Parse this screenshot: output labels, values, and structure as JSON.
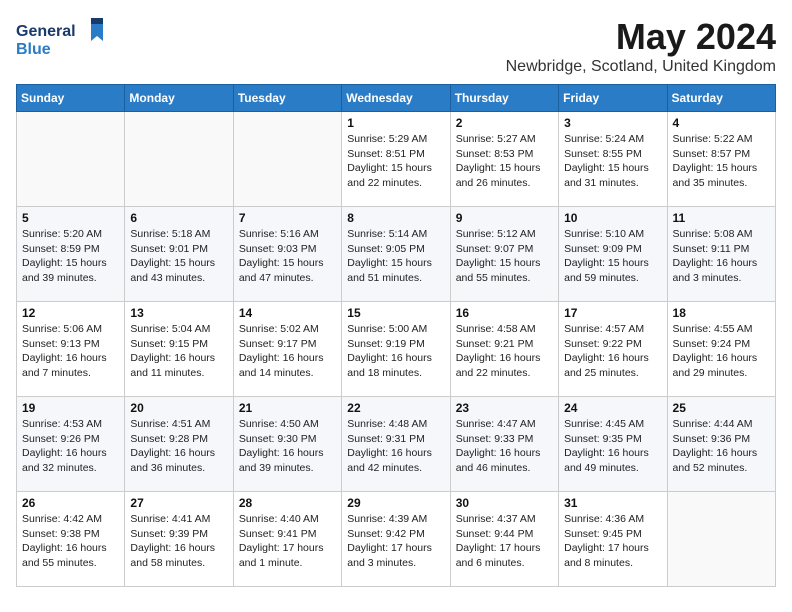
{
  "header": {
    "logo_general": "General",
    "logo_blue": "Blue",
    "month_title": "May 2024",
    "location": "Newbridge, Scotland, United Kingdom"
  },
  "days_of_week": [
    "Sunday",
    "Monday",
    "Tuesday",
    "Wednesday",
    "Thursday",
    "Friday",
    "Saturday"
  ],
  "weeks": [
    [
      {
        "day": "",
        "sunrise": "",
        "sunset": "",
        "daylight": ""
      },
      {
        "day": "",
        "sunrise": "",
        "sunset": "",
        "daylight": ""
      },
      {
        "day": "",
        "sunrise": "",
        "sunset": "",
        "daylight": ""
      },
      {
        "day": "1",
        "sunrise": "Sunrise: 5:29 AM",
        "sunset": "Sunset: 8:51 PM",
        "daylight": "Daylight: 15 hours and 22 minutes."
      },
      {
        "day": "2",
        "sunrise": "Sunrise: 5:27 AM",
        "sunset": "Sunset: 8:53 PM",
        "daylight": "Daylight: 15 hours and 26 minutes."
      },
      {
        "day": "3",
        "sunrise": "Sunrise: 5:24 AM",
        "sunset": "Sunset: 8:55 PM",
        "daylight": "Daylight: 15 hours and 31 minutes."
      },
      {
        "day": "4",
        "sunrise": "Sunrise: 5:22 AM",
        "sunset": "Sunset: 8:57 PM",
        "daylight": "Daylight: 15 hours and 35 minutes."
      }
    ],
    [
      {
        "day": "5",
        "sunrise": "Sunrise: 5:20 AM",
        "sunset": "Sunset: 8:59 PM",
        "daylight": "Daylight: 15 hours and 39 minutes."
      },
      {
        "day": "6",
        "sunrise": "Sunrise: 5:18 AM",
        "sunset": "Sunset: 9:01 PM",
        "daylight": "Daylight: 15 hours and 43 minutes."
      },
      {
        "day": "7",
        "sunrise": "Sunrise: 5:16 AM",
        "sunset": "Sunset: 9:03 PM",
        "daylight": "Daylight: 15 hours and 47 minutes."
      },
      {
        "day": "8",
        "sunrise": "Sunrise: 5:14 AM",
        "sunset": "Sunset: 9:05 PM",
        "daylight": "Daylight: 15 hours and 51 minutes."
      },
      {
        "day": "9",
        "sunrise": "Sunrise: 5:12 AM",
        "sunset": "Sunset: 9:07 PM",
        "daylight": "Daylight: 15 hours and 55 minutes."
      },
      {
        "day": "10",
        "sunrise": "Sunrise: 5:10 AM",
        "sunset": "Sunset: 9:09 PM",
        "daylight": "Daylight: 15 hours and 59 minutes."
      },
      {
        "day": "11",
        "sunrise": "Sunrise: 5:08 AM",
        "sunset": "Sunset: 9:11 PM",
        "daylight": "Daylight: 16 hours and 3 minutes."
      }
    ],
    [
      {
        "day": "12",
        "sunrise": "Sunrise: 5:06 AM",
        "sunset": "Sunset: 9:13 PM",
        "daylight": "Daylight: 16 hours and 7 minutes."
      },
      {
        "day": "13",
        "sunrise": "Sunrise: 5:04 AM",
        "sunset": "Sunset: 9:15 PM",
        "daylight": "Daylight: 16 hours and 11 minutes."
      },
      {
        "day": "14",
        "sunrise": "Sunrise: 5:02 AM",
        "sunset": "Sunset: 9:17 PM",
        "daylight": "Daylight: 16 hours and 14 minutes."
      },
      {
        "day": "15",
        "sunrise": "Sunrise: 5:00 AM",
        "sunset": "Sunset: 9:19 PM",
        "daylight": "Daylight: 16 hours and 18 minutes."
      },
      {
        "day": "16",
        "sunrise": "Sunrise: 4:58 AM",
        "sunset": "Sunset: 9:21 PM",
        "daylight": "Daylight: 16 hours and 22 minutes."
      },
      {
        "day": "17",
        "sunrise": "Sunrise: 4:57 AM",
        "sunset": "Sunset: 9:22 PM",
        "daylight": "Daylight: 16 hours and 25 minutes."
      },
      {
        "day": "18",
        "sunrise": "Sunrise: 4:55 AM",
        "sunset": "Sunset: 9:24 PM",
        "daylight": "Daylight: 16 hours and 29 minutes."
      }
    ],
    [
      {
        "day": "19",
        "sunrise": "Sunrise: 4:53 AM",
        "sunset": "Sunset: 9:26 PM",
        "daylight": "Daylight: 16 hours and 32 minutes."
      },
      {
        "day": "20",
        "sunrise": "Sunrise: 4:51 AM",
        "sunset": "Sunset: 9:28 PM",
        "daylight": "Daylight: 16 hours and 36 minutes."
      },
      {
        "day": "21",
        "sunrise": "Sunrise: 4:50 AM",
        "sunset": "Sunset: 9:30 PM",
        "daylight": "Daylight: 16 hours and 39 minutes."
      },
      {
        "day": "22",
        "sunrise": "Sunrise: 4:48 AM",
        "sunset": "Sunset: 9:31 PM",
        "daylight": "Daylight: 16 hours and 42 minutes."
      },
      {
        "day": "23",
        "sunrise": "Sunrise: 4:47 AM",
        "sunset": "Sunset: 9:33 PM",
        "daylight": "Daylight: 16 hours and 46 minutes."
      },
      {
        "day": "24",
        "sunrise": "Sunrise: 4:45 AM",
        "sunset": "Sunset: 9:35 PM",
        "daylight": "Daylight: 16 hours and 49 minutes."
      },
      {
        "day": "25",
        "sunrise": "Sunrise: 4:44 AM",
        "sunset": "Sunset: 9:36 PM",
        "daylight": "Daylight: 16 hours and 52 minutes."
      }
    ],
    [
      {
        "day": "26",
        "sunrise": "Sunrise: 4:42 AM",
        "sunset": "Sunset: 9:38 PM",
        "daylight": "Daylight: 16 hours and 55 minutes."
      },
      {
        "day": "27",
        "sunrise": "Sunrise: 4:41 AM",
        "sunset": "Sunset: 9:39 PM",
        "daylight": "Daylight: 16 hours and 58 minutes."
      },
      {
        "day": "28",
        "sunrise": "Sunrise: 4:40 AM",
        "sunset": "Sunset: 9:41 PM",
        "daylight": "Daylight: 17 hours and 1 minute."
      },
      {
        "day": "29",
        "sunrise": "Sunrise: 4:39 AM",
        "sunset": "Sunset: 9:42 PM",
        "daylight": "Daylight: 17 hours and 3 minutes."
      },
      {
        "day": "30",
        "sunrise": "Sunrise: 4:37 AM",
        "sunset": "Sunset: 9:44 PM",
        "daylight": "Daylight: 17 hours and 6 minutes."
      },
      {
        "day": "31",
        "sunrise": "Sunrise: 4:36 AM",
        "sunset": "Sunset: 9:45 PM",
        "daylight": "Daylight: 17 hours and 8 minutes."
      },
      {
        "day": "",
        "sunrise": "",
        "sunset": "",
        "daylight": ""
      }
    ]
  ]
}
